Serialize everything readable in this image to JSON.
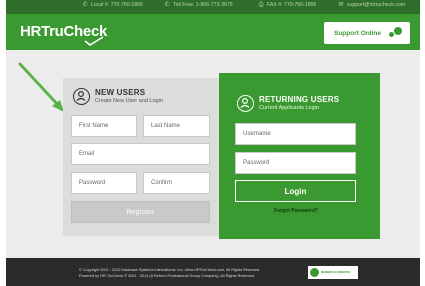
{
  "topbar": {
    "local": "Local #: 770-760-1866",
    "tollfree": "Toll Free: 1-866-773-3675",
    "fax": "FAX #: 770-760-1866",
    "email": "support@hrtrucheck.com"
  },
  "header": {
    "logo": "HRTruCheck",
    "support_label": "Support Online"
  },
  "new_users": {
    "title": "NEW USERS",
    "subtitle": "Create New User and Login",
    "first_name_placeholder": "First Name",
    "last_name_placeholder": "Last Name",
    "email_placeholder": "Email",
    "password_placeholder": "Password",
    "confirm_placeholder": "Confirm",
    "register_label": "Register"
  },
  "returning_users": {
    "title": "RETURNING USERS",
    "subtitle": "Current Applicants Login",
    "username_placeholder": "Username",
    "password_placeholder": "Password",
    "login_label": "Login",
    "forgot_label": "Forgot Password?"
  },
  "footer": {
    "copyright": "© Copyright 2001 - 2015 Database Systems International, Inc. d/b/a HRTruCheck.com, All Rights Reserved.",
    "powered": "Powered by HR-TruCheck © 2001 - 2014 (A Reform Professional Group Company), All Rights Reserved.",
    "badge_text": "MEMBER ACCREDITED"
  },
  "colors": {
    "brand_green": "#3a9a31",
    "dark_green": "#2f6d2a",
    "footer": "#2b2b2b"
  }
}
